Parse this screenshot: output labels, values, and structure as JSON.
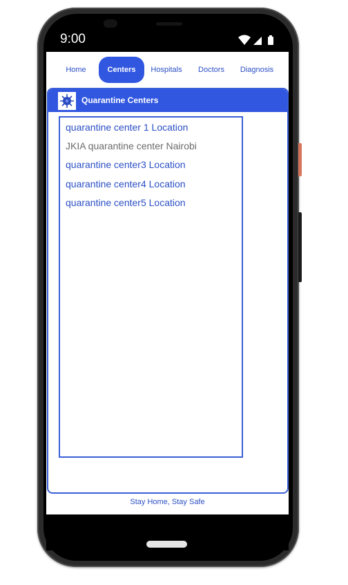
{
  "status_bar": {
    "time": "9:00",
    "icons": [
      "wifi-icon",
      "cellular-signal-icon",
      "battery-icon"
    ]
  },
  "nav": {
    "tabs": [
      {
        "label": "Home",
        "active": false
      },
      {
        "label": "Centers",
        "active": true
      },
      {
        "label": "Hospitals",
        "active": false
      },
      {
        "label": "Doctors",
        "active": false
      },
      {
        "label": "Diagnosis",
        "active": false
      }
    ]
  },
  "card": {
    "title": "Quarantine Centers",
    "logo_icon": "virus-logo-icon",
    "items": [
      "quarantine center 1 Location",
      "JKIA quarantine center Nairobi",
      "quarantine center3 Location",
      "quarantine center4 Location",
      "quarantine center5 Location"
    ]
  },
  "footer": {
    "text": "Stay Home, Stay Safe"
  },
  "colors": {
    "accent": "#3157e0",
    "link": "#2b4fc4",
    "muted_text": "#6b6b6b",
    "phone_body": "#2b2b2b",
    "side_button": "#d6735b"
  }
}
